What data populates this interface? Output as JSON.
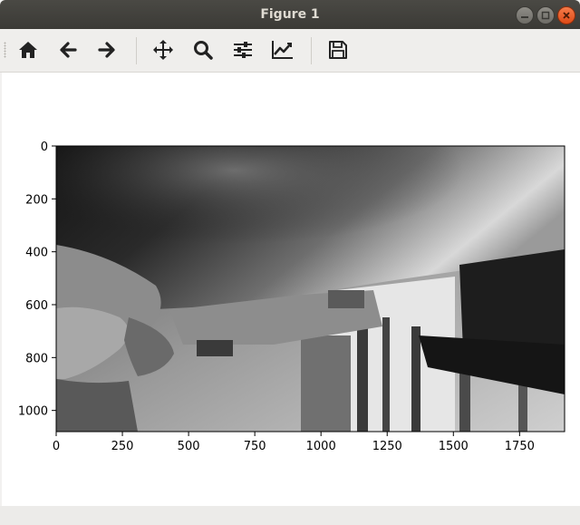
{
  "window": {
    "title": "Figure 1"
  },
  "toolbar": {
    "buttons": [
      {
        "name": "home",
        "icon": "home-icon"
      },
      {
        "name": "back",
        "icon": "arrow-left-icon"
      },
      {
        "name": "forward",
        "icon": "arrow-right-icon"
      },
      {
        "name": "pan",
        "icon": "move-icon"
      },
      {
        "name": "zoom",
        "icon": "magnifier-icon"
      },
      {
        "name": "subplots",
        "icon": "sliders-icon"
      },
      {
        "name": "axes",
        "icon": "line-chart-icon"
      },
      {
        "name": "save",
        "icon": "floppy-disk-icon"
      }
    ]
  },
  "chart_data": {
    "type": "image",
    "image_description": "grayscale camera frame",
    "x_ticks": [
      0,
      250,
      500,
      750,
      1000,
      1250,
      1500,
      1750
    ],
    "y_ticks": [
      0,
      200,
      400,
      600,
      800,
      1000
    ],
    "xlim": [
      0,
      1920
    ],
    "ylim": [
      1080,
      0
    ],
    "y_inverted": true,
    "title": "",
    "xlabel": "",
    "ylabel": ""
  },
  "colors": {
    "titlebar": "#3b3a36",
    "title_text": "#dfdbd2",
    "close_button": "#df4a16",
    "toolbar_icon": "#222222"
  }
}
